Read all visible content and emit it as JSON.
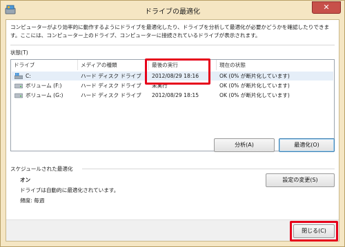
{
  "window": {
    "title": "ドライブの最適化",
    "close_glyph": "✕"
  },
  "description": "コンピューターがより効率的に動作するようにドライブを最適化したり、ドライブを分析して最適化が必要かどうかを確認したりできます。ここには、コンピューター上のドライブ、コンピューターに接続されているドライブが表示されます。",
  "status_label": "状態(T)",
  "columns": [
    "ドライブ",
    "メディアの種類",
    "最後の実行",
    "現在の状態"
  ],
  "drives": [
    {
      "name": "C:",
      "media": "ハード ディスク ドライブ",
      "last_run": "2012/08/29 18:16",
      "status": "OK (0% が断片化しています)",
      "icon": "system-drive-icon"
    },
    {
      "name": "ボリューム (F:)",
      "media": "ハード ディスク ドライブ",
      "last_run": "未実行",
      "status": "OK (0% が断片化しています)",
      "icon": "hard-drive-icon"
    },
    {
      "name": "ボリューム (G:)",
      "media": "ハード ディスク ドライブ",
      "last_run": "2012/08/29 18:15",
      "status": "OK (0% が断片化しています)",
      "icon": "hard-drive-icon"
    }
  ],
  "buttons": {
    "analyze": "分析(A)",
    "optimize": "最適化(O)",
    "change_settings": "設定の変更(S)",
    "close": "閉じる(C)"
  },
  "schedule": {
    "header": "スケジュールされた最適化",
    "state": "オン",
    "desc": "ドライブは自動的に最適化されています。",
    "freq": "頻度: 毎週"
  },
  "colors": {
    "frame": "#f5e6c3",
    "highlight": "#e6001a",
    "close": "#c7504a"
  }
}
